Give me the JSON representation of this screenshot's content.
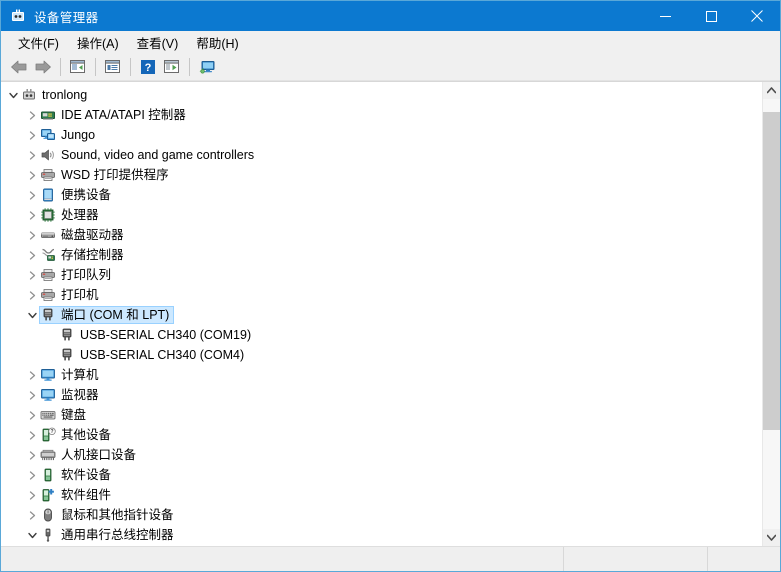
{
  "window": {
    "title": "设备管理器",
    "titlebar_color": "#0c79d0",
    "icon": "device-manager-icon"
  },
  "caption_buttons": [
    {
      "name": "minimize",
      "glyph": "minimize-icon"
    },
    {
      "name": "maximize",
      "glyph": "maximize-icon"
    },
    {
      "name": "close",
      "glyph": "close-icon"
    }
  ],
  "menubar": {
    "items": [
      {
        "label": "文件(F)",
        "name": "menu-file"
      },
      {
        "label": "操作(A)",
        "name": "menu-action"
      },
      {
        "label": "查看(V)",
        "name": "menu-view"
      },
      {
        "label": "帮助(H)",
        "name": "menu-help"
      }
    ]
  },
  "toolbar": {
    "buttons": [
      {
        "name": "back-button",
        "icon": "back-arrow-icon",
        "tip": "后退"
      },
      {
        "name": "forward-button",
        "icon": "forward-arrow-icon",
        "tip": "前进"
      },
      {
        "name": "show-hide-console-tree-button",
        "icon": "console-tree-icon",
        "tip": "显示/隐藏控制台树"
      },
      {
        "name": "properties-button",
        "icon": "properties-icon",
        "tip": "属性"
      },
      {
        "name": "help-button",
        "icon": "help-question-icon",
        "tip": "帮助"
      },
      {
        "name": "update-driver-button",
        "icon": "update-driver-icon",
        "tip": "更新驱动程序"
      },
      {
        "name": "scan-hardware-changes-button",
        "icon": "scan-hardware-icon",
        "tip": "扫描检测硬件改动"
      }
    ]
  },
  "tree": {
    "items": [
      {
        "depth": 0,
        "label": "tronlong",
        "icon": "computer-root-icon",
        "state": "expanded",
        "selected": false
      },
      {
        "depth": 1,
        "label": "IDE ATA/ATAPI 控制器",
        "icon": "ide-controller-icon",
        "state": "collapsed",
        "selected": false
      },
      {
        "depth": 1,
        "label": "Jungo",
        "icon": "network-adapter-icon",
        "state": "collapsed",
        "selected": false
      },
      {
        "depth": 1,
        "label": "Sound, video and game controllers",
        "icon": "speaker-icon",
        "state": "collapsed",
        "selected": false
      },
      {
        "depth": 1,
        "label": "WSD 打印提供程序",
        "icon": "printer-icon",
        "state": "collapsed",
        "selected": false
      },
      {
        "depth": 1,
        "label": "便携设备",
        "icon": "portable-device-icon",
        "state": "collapsed",
        "selected": false
      },
      {
        "depth": 1,
        "label": "处理器",
        "icon": "processor-icon",
        "state": "collapsed",
        "selected": false
      },
      {
        "depth": 1,
        "label": "磁盘驱动器",
        "icon": "disk-drive-icon",
        "state": "collapsed",
        "selected": false
      },
      {
        "depth": 1,
        "label": "存储控制器",
        "icon": "storage-controller-icon",
        "state": "collapsed",
        "selected": false
      },
      {
        "depth": 1,
        "label": "打印队列",
        "icon": "printer-icon",
        "state": "collapsed",
        "selected": false
      },
      {
        "depth": 1,
        "label": "打印机",
        "icon": "printer-icon",
        "state": "collapsed",
        "selected": false
      },
      {
        "depth": 1,
        "label": "端口 (COM 和 LPT)",
        "icon": "port-icon",
        "state": "expanded",
        "selected": true
      },
      {
        "depth": 2,
        "label": "USB-SERIAL CH340 (COM19)",
        "icon": "port-icon",
        "state": "leaf",
        "selected": false
      },
      {
        "depth": 2,
        "label": "USB-SERIAL CH340 (COM4)",
        "icon": "port-icon",
        "state": "leaf",
        "selected": false
      },
      {
        "depth": 1,
        "label": "计算机",
        "icon": "monitor-icon",
        "state": "collapsed",
        "selected": false
      },
      {
        "depth": 1,
        "label": "监视器",
        "icon": "monitor-icon",
        "state": "collapsed",
        "selected": false
      },
      {
        "depth": 1,
        "label": "键盘",
        "icon": "keyboard-icon",
        "state": "collapsed",
        "selected": false
      },
      {
        "depth": 1,
        "label": "其他设备",
        "icon": "unknown-device-icon",
        "state": "collapsed",
        "selected": false
      },
      {
        "depth": 1,
        "label": "人机接口设备",
        "icon": "hid-device-icon",
        "state": "collapsed",
        "selected": false
      },
      {
        "depth": 1,
        "label": "软件设备",
        "icon": "software-device-icon",
        "state": "collapsed",
        "selected": false
      },
      {
        "depth": 1,
        "label": "软件组件",
        "icon": "software-component-icon",
        "state": "collapsed",
        "selected": false
      },
      {
        "depth": 1,
        "label": "鼠标和其他指针设备",
        "icon": "mouse-icon",
        "state": "collapsed",
        "selected": false
      },
      {
        "depth": 1,
        "label": "通用串行总线控制器",
        "icon": "usb-controller-icon",
        "state": "expanded",
        "selected": false
      }
    ],
    "selection_bg": "#cce8ff",
    "selection_border": "#99d1ff"
  },
  "scrollbar": {
    "up_arrow": "scroll-up-icon",
    "down_arrow": "scroll-down-icon",
    "thumb_top_pct": 3,
    "thumb_height_pct": 74
  },
  "statusbar": {
    "cells": [
      "",
      "",
      ""
    ]
  }
}
